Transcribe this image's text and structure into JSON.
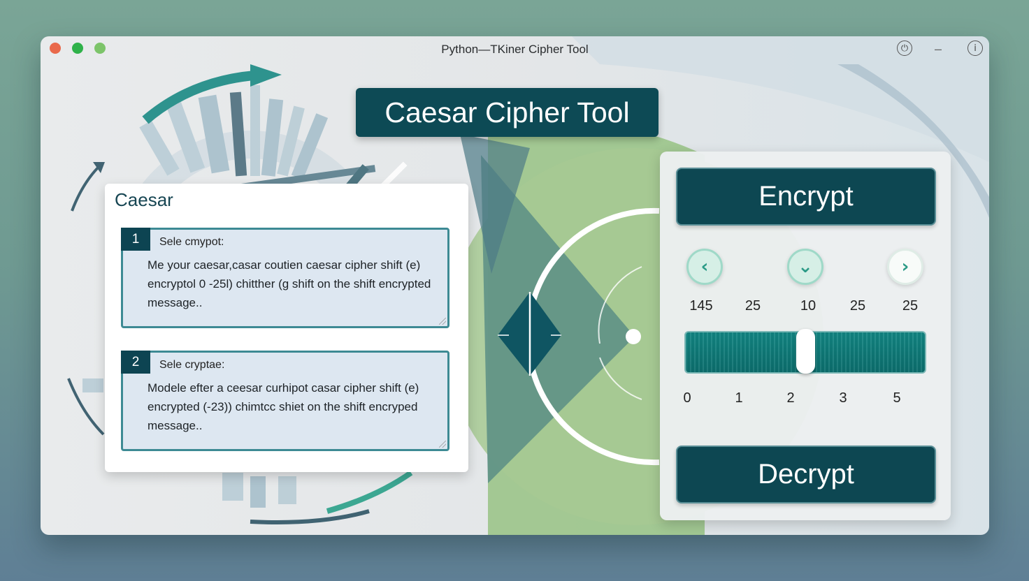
{
  "window": {
    "title": "Python—TKiner Cipher Tool",
    "info_icon_glyph": "i",
    "power_icon_glyph": "⏻",
    "minimize_glyph": "–"
  },
  "header": {
    "title": "Caesar Cipher Tool"
  },
  "left_card": {
    "title": "Caesar",
    "steps": [
      {
        "number": "1",
        "label": "Sele cmypot:",
        "body": "Me your caesar,casar coutien caesar cipher shift (e) encryptol 0 -25l) chitther (g shift on the shift encrypted message.."
      },
      {
        "number": "2",
        "label": "Sele cryptae:",
        "body": "Modele efter a ceesar curhipot casar cipher shift (e) encrypted (-23)) chimtcc shiet on the shift encryped message.."
      }
    ]
  },
  "right_panel": {
    "encrypt_label": "Encrypt",
    "decrypt_label": "Decrypt",
    "nav_buttons": [
      {
        "icon": "chevron-left-icon",
        "glyph": "‹"
      },
      {
        "icon": "chevron-down-icon",
        "glyph": "⌄"
      },
      {
        "icon": "chevron-right-icon",
        "glyph": "›"
      }
    ],
    "number_row": [
      "145",
      "25",
      "10",
      "25",
      "25"
    ],
    "slider": {
      "value_fraction": 0.5,
      "tick_labels": [
        "0",
        "1",
        "2",
        "3",
        "5"
      ]
    }
  },
  "colors": {
    "primary_dark_teal": "#0d4752",
    "accent_green": "#9bc48a",
    "slider_teal": "#128683",
    "traffic_red": "#e9694b",
    "traffic_green": "#2fb24a",
    "traffic_light_green": "#7cc46a"
  }
}
